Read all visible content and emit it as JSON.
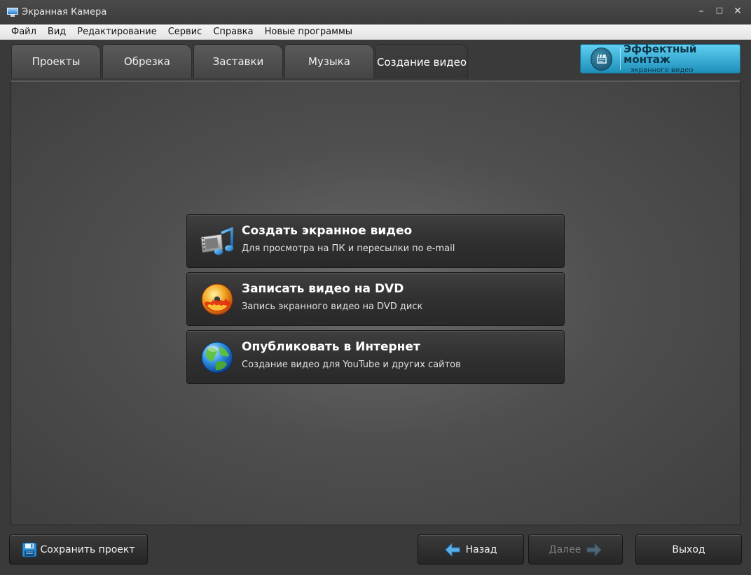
{
  "window": {
    "title": "Экранная Камера",
    "controls": {
      "minimize": "–",
      "maximize": "□",
      "close": "✕"
    }
  },
  "menu": [
    "Файл",
    "Вид",
    "Редактирование",
    "Сервис",
    "Справка",
    "Новые программы"
  ],
  "tabs": [
    {
      "label": "Проекты",
      "active": false
    },
    {
      "label": "Обрезка",
      "active": false
    },
    {
      "label": "Заставки",
      "active": false
    },
    {
      "label": "Музыка",
      "active": false
    },
    {
      "label": "Создание видео",
      "active": true
    }
  ],
  "promo": {
    "title": "Эффектный монтаж",
    "subtitle": "экранного видео",
    "icon": "clapperboard-icon"
  },
  "options": [
    {
      "title": "Создать экранное видео",
      "subtitle": "Для просмотра на ПК и пересылки по e-mail",
      "icon": "film-music-icon"
    },
    {
      "title": "Записать видео на DVD",
      "subtitle": "Запись экранного видео на DVD диск",
      "icon": "dvd-flame-icon"
    },
    {
      "title": "Опубликовать в Интернет",
      "subtitle": "Создание видео для YouTube и других сайтов",
      "icon": "globe-icon"
    }
  ],
  "footer": {
    "save": "Сохранить проект",
    "back": "Назад",
    "next": "Далее",
    "exit": "Выход"
  },
  "colors": {
    "accent": "#2aa8d4",
    "back_arrow": "#5aaee6",
    "panel_bg": "#4f4f4f"
  }
}
